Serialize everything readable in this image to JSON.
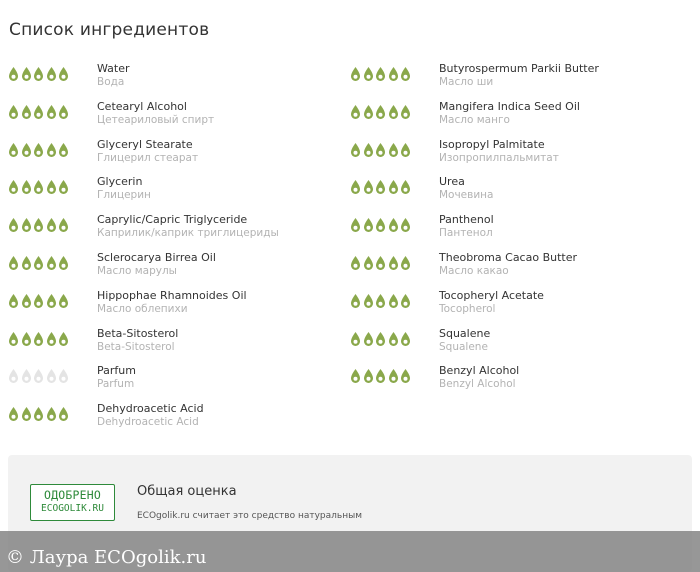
{
  "page_title": "Список ингредиентов",
  "colors": {
    "leaf_active": "#8aa84b",
    "leaf_inactive": "#e4e4e4",
    "badge_green": "#2e8a3a"
  },
  "icons": {
    "rating": "leaf-icon"
  },
  "ingredients_left": [
    {
      "name": "Water",
      "sub": "Вода",
      "rating": 5
    },
    {
      "name": "Cetearyl Alcohol",
      "sub": "Цетеариловый спирт",
      "rating": 5
    },
    {
      "name": "Glyceryl Stearate",
      "sub": "Глицерил стеарат",
      "rating": 5
    },
    {
      "name": "Glycerin",
      "sub": "Глицерин",
      "rating": 5
    },
    {
      "name": "Caprylic/Capric Triglyceride",
      "sub": "Каприлик/каприк триглицериды",
      "rating": 5
    },
    {
      "name": "Sclerocarya Birrea Oil",
      "sub": "Масло марулы",
      "rating": 5
    },
    {
      "name": "Hippophae Rhamnoides Oil",
      "sub": "Масло облепихи",
      "rating": 5
    },
    {
      "name": "Beta-Sitosterol",
      "sub": "Beta-Sitosterol",
      "rating": 5
    },
    {
      "name": "Parfum",
      "sub": "Parfum",
      "rating": 0
    },
    {
      "name": "Dehydroacetic Acid",
      "sub": "Dehydroacetic Acid",
      "rating": 5
    }
  ],
  "ingredients_right": [
    {
      "name": "Butyrospermum Parkii Butter",
      "sub": "Масло ши",
      "rating": 5
    },
    {
      "name": "Mangifera Indica Seed Oil",
      "sub": "Масло манго",
      "rating": 5
    },
    {
      "name": "Isopropyl Palmitate",
      "sub": "Изопропилпальмитат",
      "rating": 5
    },
    {
      "name": "Urea",
      "sub": "Мочевина",
      "rating": 5
    },
    {
      "name": "Panthenol",
      "sub": "Пантенол",
      "rating": 5
    },
    {
      "name": "Theobroma Cacao Butter",
      "sub": "Масло какао",
      "rating": 5
    },
    {
      "name": "Tocopheryl Acetate",
      "sub": "Tocopherol",
      "rating": 5
    },
    {
      "name": "Squalene",
      "sub": "Squalene",
      "rating": 5
    },
    {
      "name": "Benzyl Alcohol",
      "sub": "Benzyl Alcohol",
      "rating": 5
    }
  ],
  "summary": {
    "badge_line1": "ОДОБРЕНО",
    "badge_line2": "ECOGOLIK.RU",
    "title": "Общая оценка",
    "text": "ECOgolik.ru считает это средство натуральным"
  },
  "watermark": "© Лаура ECOgolik.ru"
}
